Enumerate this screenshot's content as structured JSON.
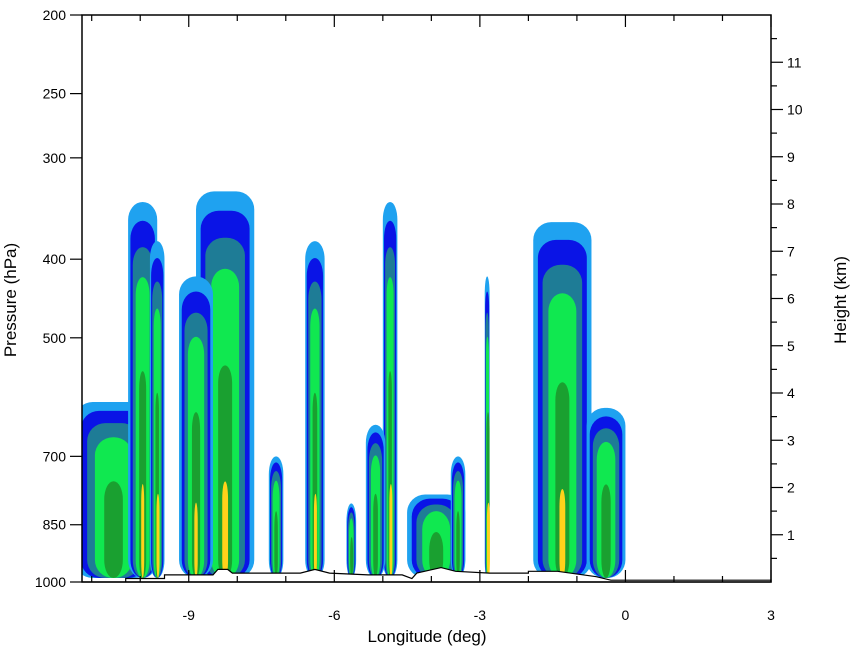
{
  "chart_data": {
    "type": "contour",
    "title": "",
    "xlabel": "Longitude (deg)",
    "ylabel": "Pressure (hPa)",
    "y2label": "Height (km)",
    "xlim": [
      -11.2,
      3
    ],
    "ylim": [
      1000,
      200
    ],
    "yscale": "log",
    "y2lim": [
      0,
      12
    ],
    "x_ticks": [
      -9,
      -6,
      -3,
      0,
      3
    ],
    "x_tick_labels": [
      "-9",
      "-6",
      "-3",
      "0",
      "3"
    ],
    "y_ticks": [
      200,
      250,
      300,
      400,
      500,
      700,
      850,
      1000
    ],
    "y_tick_labels": [
      "200",
      "250",
      "300",
      "400",
      "500",
      "700",
      "850",
      "1000"
    ],
    "y2_ticks": [
      1,
      2,
      3,
      4,
      5,
      6,
      7,
      8,
      9,
      10,
      11
    ],
    "y2_tick_labels": [
      "1",
      "2",
      "3",
      "4",
      "5",
      "6",
      "7",
      "8",
      "9",
      "10",
      "11"
    ],
    "levels_colors": [
      "#1fa2f0",
      "#0a14e6",
      "#1e7c96",
      "#10e850",
      "#1aa030",
      "#ffd21a"
    ],
    "terrain_line_color": "#000000",
    "grid": false,
    "legend": "none"
  }
}
